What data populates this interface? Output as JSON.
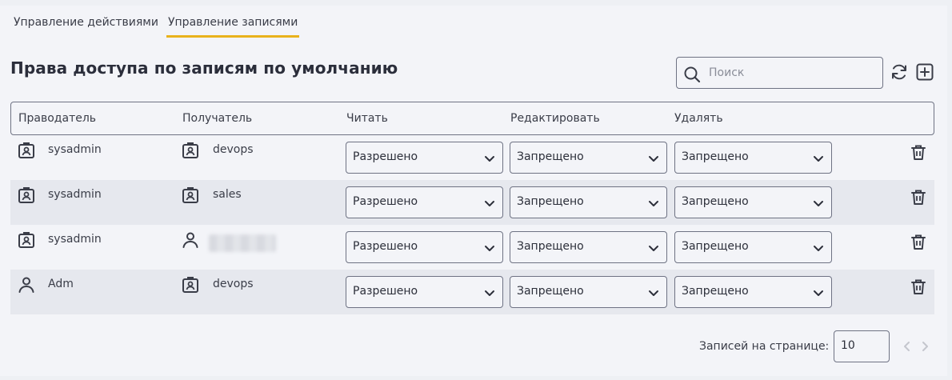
{
  "tabs": [
    {
      "label": "Управление действиями",
      "active": false
    },
    {
      "label": "Управление записями",
      "active": true
    }
  ],
  "page_title": "Права доступа по записям по умолчанию",
  "search": {
    "placeholder": "Поиск",
    "value": ""
  },
  "toolbar": {
    "refresh_icon": "refresh-icon",
    "add_icon": "add-square-icon"
  },
  "table": {
    "headers": {
      "grantor": "Праводатель",
      "recipient": "Получатель",
      "read": "Читать",
      "edit": "Редактировать",
      "delete": "Удалять"
    },
    "rows": [
      {
        "grantor": "sysadmin",
        "grantor_icon": "group-badge-icon",
        "recipient": "devops",
        "recipient_icon": "group-badge-icon",
        "read": "Разрешено",
        "edit": "Запрещено",
        "delete": "Запрещено"
      },
      {
        "grantor": "sysadmin",
        "grantor_icon": "group-badge-icon",
        "recipient": "sales",
        "recipient_icon": "group-badge-icon",
        "read": "Разрешено",
        "edit": "Запрещено",
        "delete": "Запрещено"
      },
      {
        "grantor": "sysadmin",
        "grantor_icon": "group-badge-icon",
        "recipient": "",
        "recipient_icon": "user-icon",
        "read": "Разрешено",
        "edit": "Запрещено",
        "delete": "Запрещено"
      },
      {
        "grantor": "Adm",
        "grantor_icon": "user-icon",
        "recipient": "devops",
        "recipient_icon": "group-badge-icon",
        "read": "Разрешено",
        "edit": "Запрещено",
        "delete": "Запрещено"
      }
    ]
  },
  "pagination": {
    "label": "Записей на странице:",
    "page_size": "10"
  },
  "colors": {
    "accent": "#e9b21c",
    "border": "#6e7283",
    "row_alt": "#e6e8ee",
    "background": "#f3f4f8"
  }
}
